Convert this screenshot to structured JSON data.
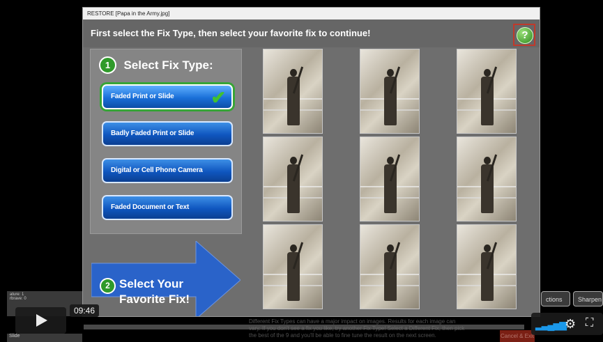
{
  "window": {
    "title": "RESTORE  [Papa in the Army.jpg]"
  },
  "header": {
    "instruction": "First select the Fix Type, then select your favorite fix to continue!",
    "help_symbol": "?"
  },
  "step1": {
    "number": "1",
    "label": "Select Fix Type:"
  },
  "fix_types": [
    {
      "label": "Faded Print or Slide",
      "selected": true
    },
    {
      "label": "Badly Faded Print or Slide",
      "selected": false
    },
    {
      "label": "Digital or Cell Phone Camera",
      "selected": false
    },
    {
      "label": "Faded Document or Text",
      "selected": false
    }
  ],
  "step2": {
    "number": "2",
    "label_line1": "Select Your",
    "label_line2": "Favorite Fix!"
  },
  "thumbnails": {
    "count": 9,
    "icon": "soldier-photo"
  },
  "side_buttons": {
    "left_line1": "ature: 1",
    "left_line2": "rbrave: 0",
    "slide_label": "Slide",
    "right1": "ctions",
    "right2": "Sharpen"
  },
  "notice": {
    "line1": "Different Fix Types can have a major impact on images. Results for each image can",
    "line2": "vary. If you don't see a fix you like, try another Fix Type! Select a Different Fix, then pick",
    "line3": "the best of the 9 and you'll be able to fine tune the result on the next screen.",
    "red_button": "Cancel & Exit"
  },
  "video_player": {
    "timecode": "09:46",
    "progress": 0.0,
    "icons": [
      "play-icon",
      "volume-icon",
      "gear-icon",
      "fullscreen-icon"
    ]
  },
  "colors": {
    "accent_blue": "#1a6fd8",
    "step_green": "#2f9a2a",
    "player_blue": "#1ea7ff",
    "help_border": "#c0392b"
  }
}
